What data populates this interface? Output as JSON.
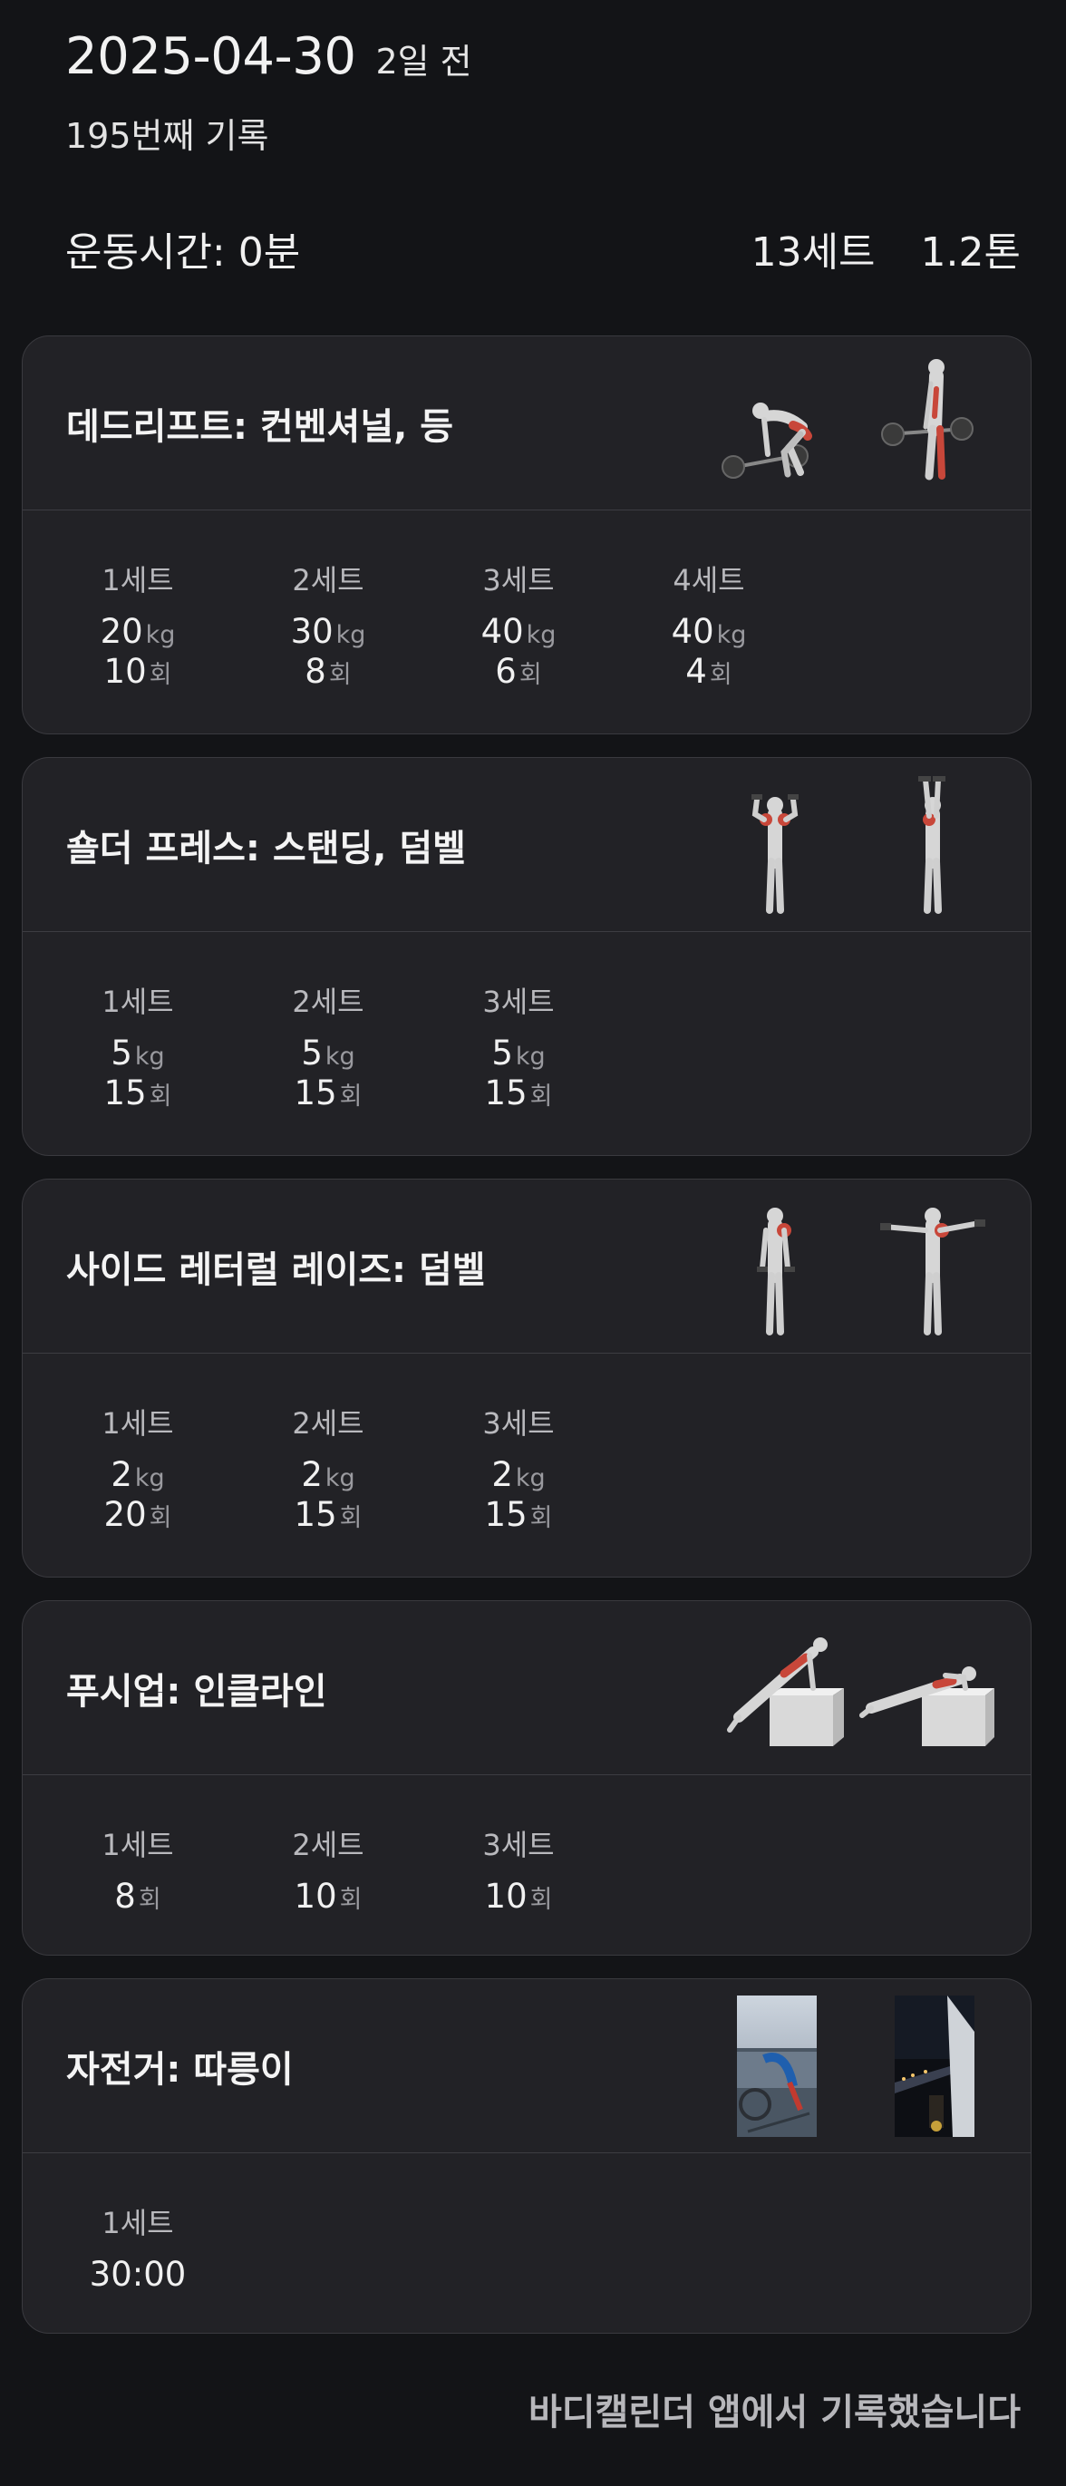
{
  "header": {
    "date": "2025-04-30",
    "ago": "2일 전",
    "record": "195번째 기록"
  },
  "stats": {
    "duration": "운동시간: 0분",
    "sets": "13세트",
    "volume": "1.2톤"
  },
  "exercises": [
    {
      "title": "데드리프트: 컨벤셔널, 등",
      "sets": [
        {
          "label": "1세트",
          "weight": "20",
          "wunit": "kg",
          "reps": "10",
          "runit": "회"
        },
        {
          "label": "2세트",
          "weight": "30",
          "wunit": "kg",
          "reps": "8",
          "runit": "회"
        },
        {
          "label": "3세트",
          "weight": "40",
          "wunit": "kg",
          "reps": "6",
          "runit": "회"
        },
        {
          "label": "4세트",
          "weight": "40",
          "wunit": "kg",
          "reps": "4",
          "runit": "회"
        }
      ]
    },
    {
      "title": "숄더 프레스: 스탠딩, 덤벨",
      "sets": [
        {
          "label": "1세트",
          "weight": "5",
          "wunit": "kg",
          "reps": "15",
          "runit": "회"
        },
        {
          "label": "2세트",
          "weight": "5",
          "wunit": "kg",
          "reps": "15",
          "runit": "회"
        },
        {
          "label": "3세트",
          "weight": "5",
          "wunit": "kg",
          "reps": "15",
          "runit": "회"
        }
      ]
    },
    {
      "title": "사이드 레터럴 레이즈: 덤벨",
      "sets": [
        {
          "label": "1세트",
          "weight": "2",
          "wunit": "kg",
          "reps": "20",
          "runit": "회"
        },
        {
          "label": "2세트",
          "weight": "2",
          "wunit": "kg",
          "reps": "15",
          "runit": "회"
        },
        {
          "label": "3세트",
          "weight": "2",
          "wunit": "kg",
          "reps": "15",
          "runit": "회"
        }
      ]
    },
    {
      "title": "푸시업: 인클라인",
      "sets": [
        {
          "label": "1세트",
          "reps": "8",
          "runit": "회"
        },
        {
          "label": "2세트",
          "reps": "10",
          "runit": "회"
        },
        {
          "label": "3세트",
          "reps": "10",
          "runit": "회"
        }
      ]
    },
    {
      "title": "자전거: 따릉이",
      "sets": [
        {
          "label": "1세트",
          "time": "30:00"
        }
      ]
    }
  ],
  "footer": "바디캘린더 앱에서 기록했습니다",
  "colors": {
    "background": "#131417",
    "card": "#222226",
    "muscle_highlight": "#c8473a"
  }
}
